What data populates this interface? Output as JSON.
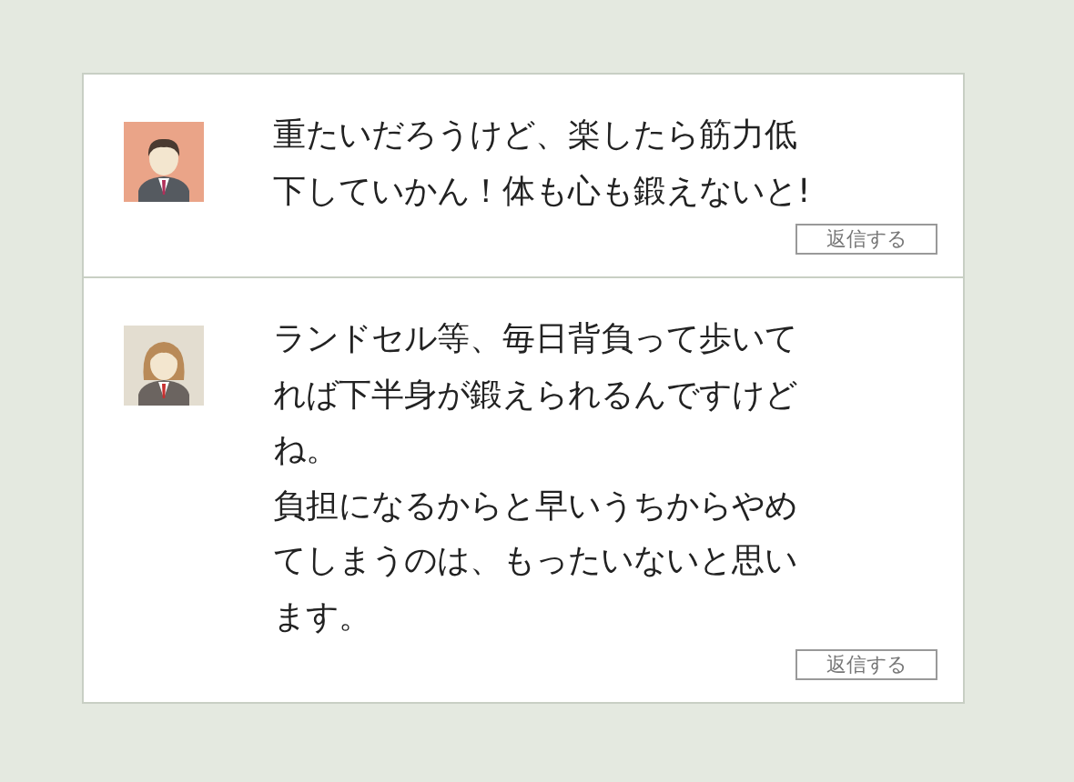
{
  "comments": [
    {
      "avatar": {
        "kind": "man"
      },
      "paragraphs": [
        "重たいだろうけど、楽したら筋力低下していかん！体も心も鍛えないと!"
      ],
      "reply_button": "返信する"
    },
    {
      "avatar": {
        "kind": "woman"
      },
      "paragraphs": [
        "ランドセル等、毎日背負って歩いてれば下半身が鍛えられるんですけどね。",
        "負担になるからと早いうちからやめてしまうのは、もったいないと思います。"
      ],
      "reply_button": "返信する"
    }
  ]
}
